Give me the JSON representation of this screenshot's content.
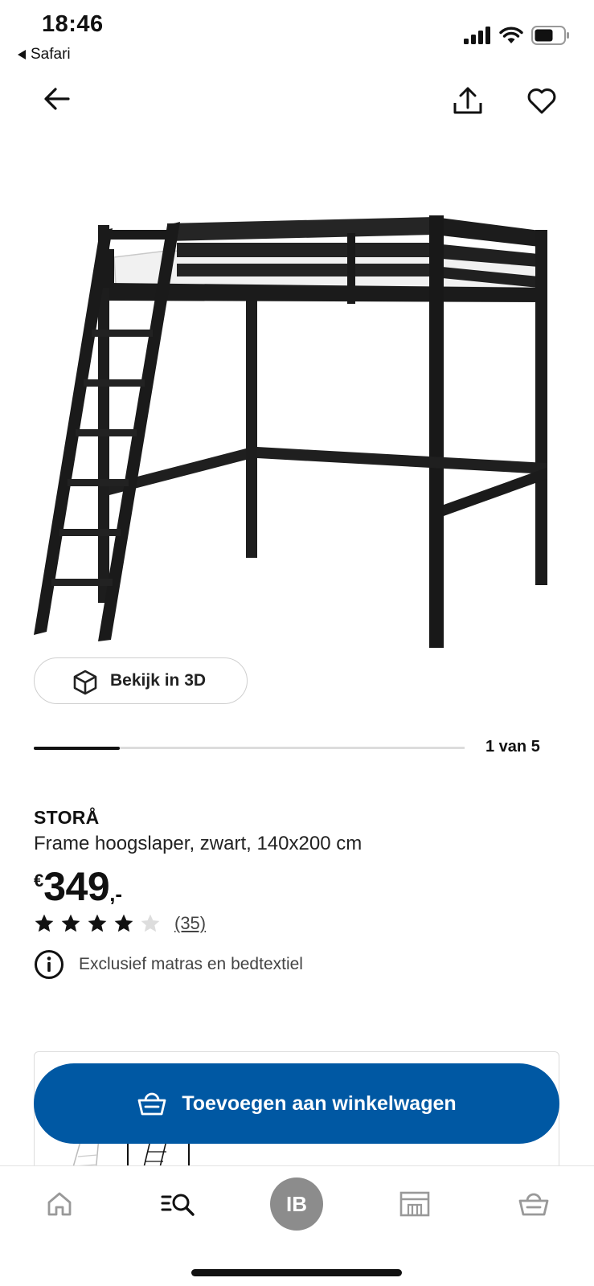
{
  "status_bar": {
    "time": "18:46",
    "back_app": "Safari",
    "icons": [
      "signal-icon",
      "wifi-icon",
      "battery-icon"
    ]
  },
  "nav": {
    "icons": [
      "back-arrow-icon",
      "share-icon",
      "heart-icon"
    ]
  },
  "gallery": {
    "view_3d_label": "Bekijk in 3D",
    "position_label": "1 van 5",
    "progress": 0.2
  },
  "product": {
    "name": "STORÅ",
    "description": "Frame hoogslaper, zwart, 140x200 cm",
    "price_currency": "€",
    "price_amount": "349",
    "price_suffix": ",-",
    "rating": 4,
    "rating_max": 5,
    "review_count": "(35)",
    "info_note": "Exclusief matras en bedtextiel"
  },
  "actions": {
    "add_to_cart_label": "Toevoegen aan winkelwagen"
  },
  "tabbar": {
    "profile_initials": "IB",
    "icons": [
      "home-icon",
      "search-icon",
      "avatar",
      "store-icon",
      "basket-icon"
    ]
  },
  "colors": {
    "brand_blue": "#0058a3",
    "star": "#111111",
    "star_empty": "#dddddd",
    "avatar_gray": "#8c8c8c"
  }
}
